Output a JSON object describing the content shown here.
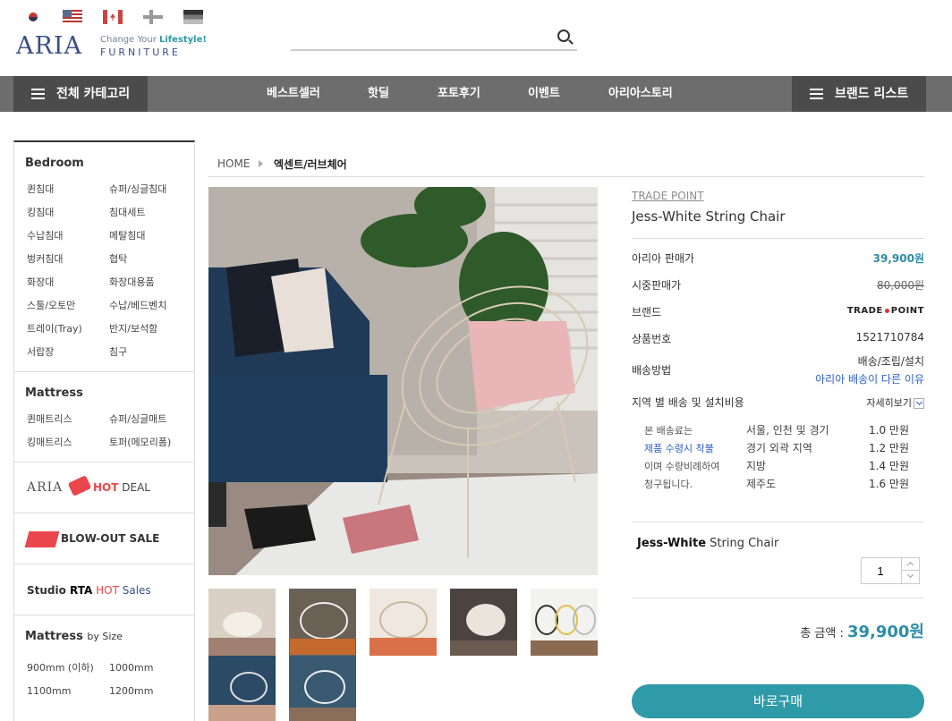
{
  "header": {
    "flags": [
      "kr",
      "us",
      "ca",
      "fi",
      "de"
    ],
    "logo": {
      "mark": "ARIA",
      "tagline_pre": "Change Your ",
      "tagline_accent": "Lifestyle!",
      "sub": "FURNITURE"
    },
    "search": {
      "value": "",
      "placeholder": ""
    }
  },
  "nav": {
    "category_button": "전체 카테고리",
    "links": [
      "베스트셀러",
      "핫딜",
      "포토후기",
      "이벤트",
      "아리아스토리"
    ],
    "brand_button": "브랜드 리스트"
  },
  "sidebar": {
    "bedroom": {
      "title": "Bedroom",
      "items": [
        "퀸침대",
        "슈퍼/싱글침대",
        "킹침대",
        "침대세트",
        "수납침대",
        "메탈침대",
        "벙커침대",
        "협탁",
        "화장대",
        "화장대용품",
        "스툴/오토만",
        "수납/베드벤치",
        "트레이(Tray)",
        "반지/보석함",
        "서랍장",
        "침구"
      ]
    },
    "mattress": {
      "title": "Mattress",
      "items": [
        "퀸매트리스",
        "슈퍼/싱글매트",
        "킹매트리스",
        "토퍼(메모리폼)"
      ]
    },
    "banners": {
      "hotdeal_logo": "ARIA",
      "hotdeal_hot": "HOT",
      "hotdeal_deal": " DEAL",
      "blowout": "BLOW-OUT SALE",
      "studio_pre": "Studio ",
      "studio_rta": "RTA",
      "studio_hot": " HOT",
      "studio_sales": " Sales"
    },
    "by_size": {
      "title": "Mattress",
      "sub": "by Size",
      "items": [
        "900mm (이하)",
        "1000mm",
        "1100mm",
        "1200mm"
      ]
    }
  },
  "breadcrumb": {
    "home": "HOME",
    "current": "엑센트/러브체어"
  },
  "product": {
    "brand_link": "TRADE POINT",
    "name": "Jess-White String Chair",
    "rows": {
      "sale_label": "아리아 판매가",
      "sale_price": "39,900원",
      "market_label": "시중판매가",
      "market_price": "80,000원",
      "brand_label": "브랜드",
      "brand_logo_left": "TRADE",
      "brand_logo_right": "POINT",
      "code_label": "상품번호",
      "code": "1521710784",
      "delivery_label": "배송방법",
      "delivery_value": "배송/조립/설치",
      "delivery_link": "아리아 배송이 다른 이유"
    },
    "fee": {
      "title": "지역 별 배송 및 설치비용",
      "detail_button": "자세히보기",
      "notes": [
        "본 배송료는",
        "제품 수령시 착불",
        "이며 수량비례하여",
        "청구됩니다."
      ],
      "areas": [
        "서울, 인천 및 경기",
        "경기 외곽 지역",
        "지방",
        "제주도"
      ],
      "prices": [
        "1.0 만원",
        "1.2 만원",
        "1.4 만원",
        "1.6 만원"
      ]
    },
    "option": {
      "name_bold": "Jess-White",
      "name_rest": " String Chair",
      "quantity": "1"
    },
    "total_label": "총 금액 : ",
    "total_price": "39,900원",
    "buy_button": "바로구매"
  },
  "colors": {
    "accent": "#2f9aa8",
    "nav_bg": "#6d6d6d",
    "nav_dark": "#4b4b4b",
    "hot": "#e9474b",
    "logo": "#3a4f86"
  }
}
